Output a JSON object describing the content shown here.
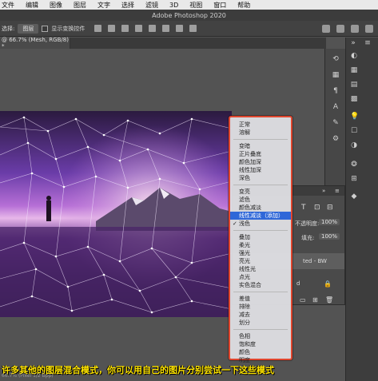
{
  "menubar": {
    "items": [
      "文件",
      "编辑",
      "图像",
      "图层",
      "文字",
      "选择",
      "滤镜",
      "3D",
      "视图",
      "窗口",
      "帮助"
    ]
  },
  "app_title": "Adobe Photoshop 2020",
  "options": {
    "select_label": "选择:",
    "select_value": "图层",
    "checkbox_label": "显示变换控件"
  },
  "doc_tab": "@ 66.7% (Mesh, RGB/8) *",
  "layers": {
    "opacity_label": "不透明度:",
    "opacity_value": "100%",
    "fill_label": "填充:",
    "fill_value": "100%",
    "layer_name": "ted - BW",
    "lock_label": "d"
  },
  "blend_menu": {
    "groups": [
      [
        "正常",
        "溶解"
      ],
      [
        "变暗",
        "正片叠底",
        "颜色加深",
        "线性加深",
        "深色"
      ],
      [
        "变亮",
        "滤色",
        "颜色减淡",
        "线性减淡（添加）",
        "浅色"
      ],
      [
        "叠加",
        "柔光",
        "强光",
        "亮光",
        "线性光",
        "点光",
        "实色混合"
      ],
      [
        "差值",
        "排除",
        "减去",
        "划分"
      ],
      [
        "色相",
        "饱和度",
        "颜色",
        "明度"
      ]
    ],
    "selected": "线性减淡（添加）",
    "checked": "浅色",
    "accent": "#2f67d8",
    "border_color": "#e0462e"
  },
  "subtitle": "许多其他的图层混合模式，你可以用自己的图片分别尝试一下这些模式",
  "status": "66.7%  (Pixel 1/2 Bpp)"
}
